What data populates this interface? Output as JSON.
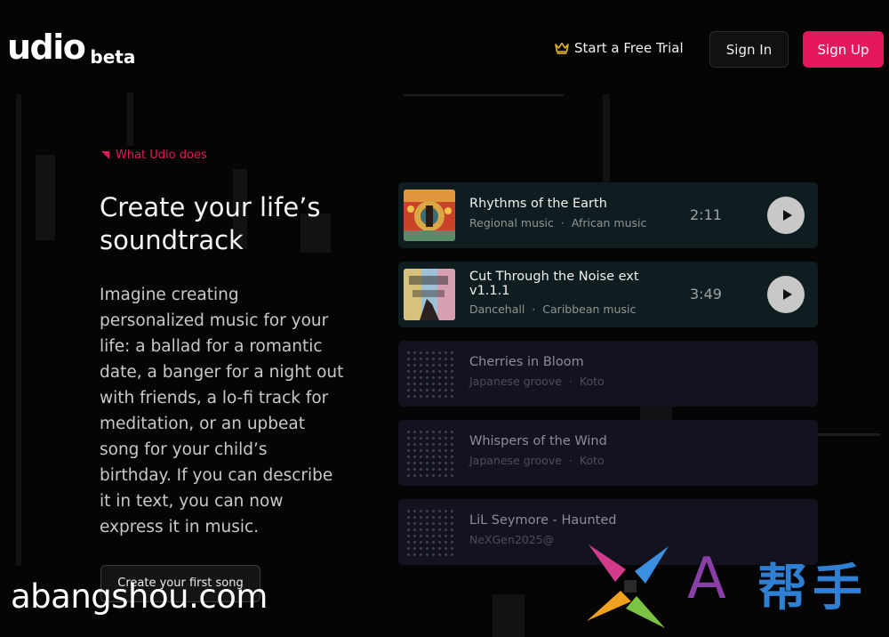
{
  "header": {
    "logo": "udio",
    "logo_badge": "beta",
    "trial_label": "Start a Free Trial",
    "signin_label": "Sign In",
    "signup_label": "Sign Up"
  },
  "hero": {
    "eyebrow": "What Udio does",
    "headline": "Create your life’s soundtrack",
    "body": "Imagine creating personalized music for your life: a ballad for a romantic date, a banger for a night out with friends, a lo-fi track for meditation, or an upbeat song for your child’s birthday. If you can describe it in text, you can now express it in music.",
    "cta_label": "Create your first song"
  },
  "tracks": [
    {
      "title": "Rhythms of the Earth",
      "genre": "Regional music",
      "tag": "African music",
      "duration": "2:11"
    },
    {
      "title": "Cut Through the Noise ext v1.1.1",
      "genre": "Dancehall",
      "tag": "Caribbean music",
      "duration": "3:49"
    },
    {
      "title": "Cherries in Bloom",
      "genre": "Japanese groove",
      "tag": "Koto"
    },
    {
      "title": "Whispers of the Wind",
      "genre": "Japanese groove",
      "tag": "Koto"
    },
    {
      "title": "LiL Seymore - Haunted",
      "genre": "NeXGen2025@"
    }
  ],
  "watermark": {
    "site": "abangshou.com",
    "letter": "A",
    "cn": "帮手"
  },
  "colors": {
    "accent": "#e5185f",
    "background": "#050506",
    "active_card": "#0f1d20",
    "muted_card": "#131320"
  }
}
